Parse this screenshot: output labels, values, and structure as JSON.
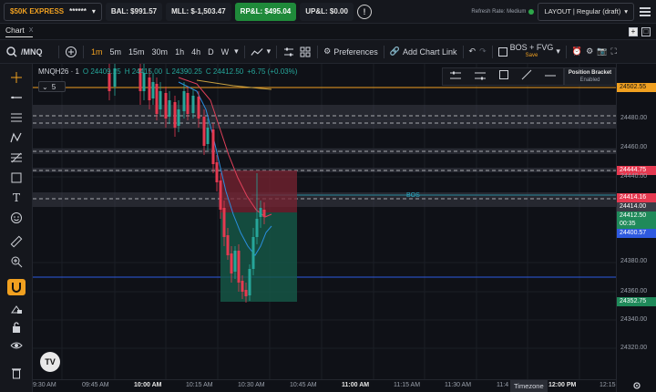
{
  "topbar": {
    "account_name": "$50K EXPRESS",
    "account_mask": "******",
    "bal": "BAL: $991.57",
    "mll": "MLL: $-1,503.47",
    "rpl": "RP&L: $495.04",
    "upl": "UP&L: $0.00",
    "refresh_label": "Refresh Rate: Medium",
    "layout_label": "LAYOUT | Regular (draft)"
  },
  "tabbar": {
    "tab_label": "Chart",
    "tab_close": "X"
  },
  "toolbar": {
    "symbol": "/MNQ",
    "timeframes": [
      "1m",
      "5m",
      "15m",
      "30m",
      "1h",
      "4h",
      "D",
      "W"
    ],
    "active_timeframe": "1m",
    "preferences_label": "Preferences",
    "add_chart_link_label": "Add Chart Link",
    "indicator_label": "BOS + FVG",
    "save_label": "Save"
  },
  "legend": {
    "symbol": "MNQH26 · 1",
    "open": "O 24409.25",
    "high": "H 24415.00",
    "low": "L 24390.25",
    "close": "C 24412.50",
    "change": "+6.75 (+0.03%)",
    "badge": "5"
  },
  "position_bracket": {
    "title": "Position Bracket",
    "status": "Enabled"
  },
  "chart_annotations": {
    "bos_label": "BOS"
  },
  "price_axis": {
    "ticks": [
      "24480.00",
      "24460.00",
      "24440.00",
      "24380.00",
      "24360.00",
      "24340.00",
      "24320.00"
    ],
    "tags": [
      {
        "label": "24502.55",
        "color": "#f0a020",
        "text_color": "#111111"
      },
      {
        "label": "24444.75",
        "color": "#e53950",
        "text_color": "#ffffff"
      },
      {
        "label": "24414.16",
        "color": "#e53950",
        "text_color": "#ffffff"
      },
      {
        "label": "24414.00",
        "color": "#3a3d46",
        "text_color": "#ffffff"
      },
      {
        "label": "24412.50",
        "color": "#1f8a5a",
        "text_color": "#ffffff"
      },
      {
        "label": "00:35",
        "color": "#1f8a5a",
        "text_color": "#ffffff"
      },
      {
        "label": "24400.57",
        "color": "#2e5ae0",
        "text_color": "#ffffff"
      },
      {
        "label": "24352.75",
        "color": "#1f8a5a",
        "text_color": "#ffffff"
      }
    ]
  },
  "time_axis": {
    "labels": [
      "9:30 AM",
      "09:45 AM",
      "10:00 AM",
      "10:15 AM",
      "10:30 AM",
      "10:45 AM",
      "11:00 AM",
      "11:15 AM",
      "11:30 AM",
      "11:4",
      "12:00 PM",
      "12:15"
    ],
    "timezone_label": "Timezone"
  },
  "colors": {
    "accent": "#f0a020",
    "bull": "#26a69a",
    "bear": "#e53950",
    "blue_line": "#2e5ae0"
  }
}
